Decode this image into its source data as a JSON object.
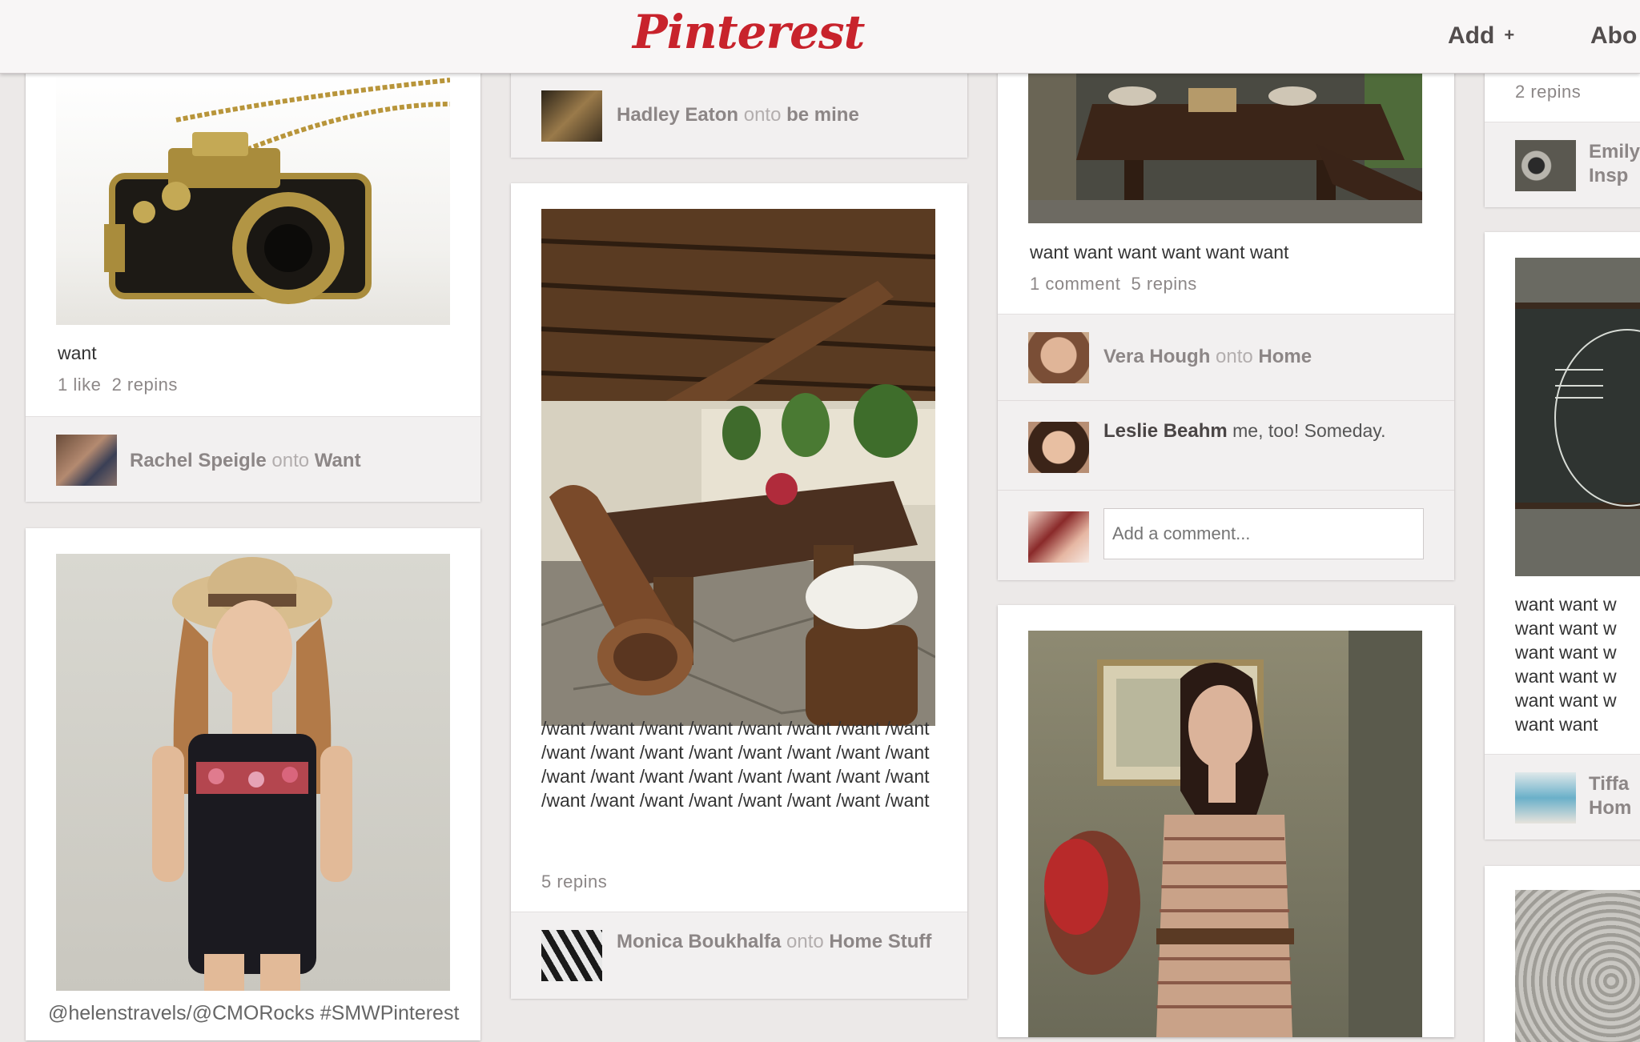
{
  "header": {
    "logo": "Pinterest",
    "add_label": "Add",
    "add_icon": "+",
    "about_label": "Abo"
  },
  "pins": {
    "camera": {
      "description": "want",
      "stats": "1 like  2 repins",
      "user": "Rachel Speigle",
      "onto": "onto",
      "board": "Want"
    },
    "hadley": {
      "user": "Hadley Eaton",
      "onto": "onto",
      "board": "be mine"
    },
    "dress": {},
    "patio": {
      "description": "/want /want /want /want /want /want /want /want /want /want /want /want /want /want /want /want /want /want /want /want /want /want /want /want /want /want /want /want /want /want /want /want",
      "stats": "5 repins",
      "user": "Monica Boukhalfa",
      "onto": "onto",
      "board": "Home Stuff"
    },
    "table": {
      "description": "want want want want want want",
      "stats": "1 comment  5 repins",
      "user": "Vera Hough",
      "onto": "onto",
      "board": "Home",
      "comment_user": "Leslie Beahm",
      "comment_text": "me, too! Someday.",
      "comment_placeholder": "Add a comment..."
    },
    "woman": {},
    "right_top": {
      "stats": "2 repins",
      "user": "Emily",
      "board": "Insp"
    },
    "right_chalk": {
      "description": "want want w want want w want want w want want w want want w want want",
      "user": "Tiffa",
      "board": "Hom"
    }
  },
  "footer": {
    "credit": "@helenstravels/@CMORocks #SMWPinterest"
  },
  "colors": {
    "brand": "#c8232c",
    "background": "#ece9e8"
  }
}
